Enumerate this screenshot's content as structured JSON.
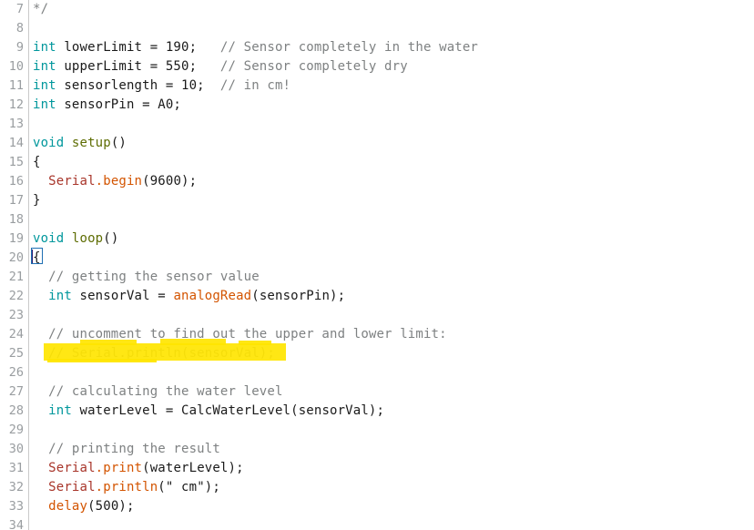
{
  "editor": {
    "language": "arduino-cpp",
    "first_line_number": 7,
    "last_line_number": 34,
    "highlight_color": "#ffe500",
    "gutter_color": "#999da0",
    "background": "#ffffff",
    "colors": {
      "keyword": "#00979c",
      "function": "#d35400",
      "object": "#a8352a",
      "structure": "#5e6d03",
      "comment": "#7e8182",
      "plain": "#1a1a1a",
      "brace_match_border": "#1f6fb2"
    }
  },
  "lines": [
    {
      "n": "7",
      "text": "*/"
    },
    {
      "n": "8",
      "text": ""
    },
    {
      "n": "9",
      "text": "int lowerLimit = 190;   // Sensor completely in the water"
    },
    {
      "n": "10",
      "text": "int upperLimit = 550;   // Sensor completely dry"
    },
    {
      "n": "11",
      "text": "int sensorlength = 10;  // in cm!"
    },
    {
      "n": "12",
      "text": "int sensorPin = A0;"
    },
    {
      "n": "13",
      "text": ""
    },
    {
      "n": "14",
      "text": "void setup()"
    },
    {
      "n": "15",
      "text": "{"
    },
    {
      "n": "16",
      "text": "  Serial.begin(9600);"
    },
    {
      "n": "17",
      "text": "}"
    },
    {
      "n": "18",
      "text": ""
    },
    {
      "n": "19",
      "text": "void loop()"
    },
    {
      "n": "20",
      "text": "{"
    },
    {
      "n": "21",
      "text": "  // getting the sensor value"
    },
    {
      "n": "22",
      "text": "  int sensorVal = analogRead(sensorPin);"
    },
    {
      "n": "23",
      "text": ""
    },
    {
      "n": "24",
      "text": "  // uncomment to find out the upper and lower limit:"
    },
    {
      "n": "25",
      "text": "  // Serial.println(sensorVal);"
    },
    {
      "n": "26",
      "text": ""
    },
    {
      "n": "27",
      "text": "  // calculating the water level"
    },
    {
      "n": "28",
      "text": "  int waterLevel = CalcWaterLevel(sensorVal);"
    },
    {
      "n": "29",
      "text": ""
    },
    {
      "n": "30",
      "text": "  // printing the result"
    },
    {
      "n": "31",
      "text": "  Serial.print(waterLevel);"
    },
    {
      "n": "32",
      "text": "  Serial.println(\" cm\");"
    },
    {
      "n": "33",
      "text": "  delay(500);"
    },
    {
      "n": "34",
      "text": ""
    }
  ],
  "tokens": {
    "l7": {
      "c1": "*/"
    },
    "l9": {
      "kw": "int",
      "mid": " lowerLimit = 190;   ",
      "cmt": "// Sensor completely in the water"
    },
    "l10": {
      "kw": "int",
      "mid": " upperLimit = 550;   ",
      "cmt": "// Sensor completely dry"
    },
    "l11": {
      "kw": "int",
      "mid": " sensorlength = 10;  ",
      "cmt": "// in cm!"
    },
    "l12": {
      "kw": "int",
      "mid": " sensorPin = A0;"
    },
    "l14": {
      "kw": "void",
      "sp": " ",
      "st": "setup",
      "tail": "()"
    },
    "l15": {
      "brace": "{"
    },
    "l16": {
      "indent": "  ",
      "obj": "Serial",
      "fn": ".begin",
      "tail": "(9600);"
    },
    "l17": {
      "brace": "}"
    },
    "l19": {
      "kw": "void",
      "sp": " ",
      "st": "loop",
      "tail": "()"
    },
    "l20": {
      "brace": "{"
    },
    "l21": {
      "indent": "  ",
      "cmt": "// getting the sensor value"
    },
    "l22": {
      "indent": "  ",
      "kw": "int",
      "mid": " sensorVal = ",
      "fn": "analogRead",
      "tail": "(sensorPin);"
    },
    "l24": {
      "indent": "  ",
      "cmt": "// uncomment to find out the upper and lower limit:"
    },
    "l25": {
      "indent": "  ",
      "cmt": "// Serial.println(sensorVal);"
    },
    "l27": {
      "indent": "  ",
      "cmt": "// calculating the water level"
    },
    "l28": {
      "indent": "  ",
      "kw": "int",
      "mid": " waterLevel = CalcWaterLevel(sensorVal);"
    },
    "l30": {
      "indent": "  ",
      "cmt": "// printing the result"
    },
    "l31": {
      "indent": "  ",
      "obj": "Serial",
      "fn": ".print",
      "tail": "(waterLevel);"
    },
    "l32": {
      "indent": "  ",
      "obj": "Serial",
      "fn": ".println",
      "tail": "(\" cm\");"
    },
    "l33": {
      "indent": "  ",
      "fn": "delay",
      "tail": "(500);"
    }
  }
}
